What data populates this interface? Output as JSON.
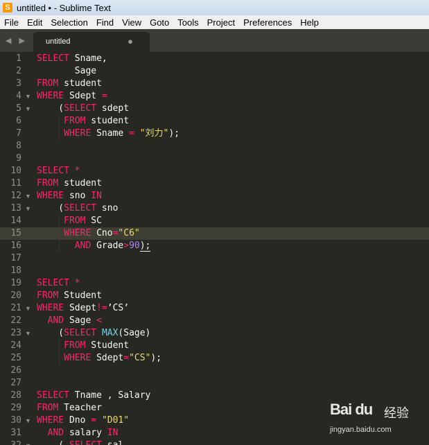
{
  "window": {
    "title": "untitled • - Sublime Text"
  },
  "menu": [
    "File",
    "Edit",
    "Selection",
    "Find",
    "View",
    "Goto",
    "Tools",
    "Project",
    "Preferences",
    "Help"
  ],
  "tab": {
    "label": "untitled",
    "dirty_indicator": "●"
  },
  "nav": {
    "arrows": "◀ ▶"
  },
  "highlighted_line": 15,
  "lines": [
    {
      "n": "1",
      "fold": false,
      "tokens": [
        {
          "t": "SELECT",
          "c": "kw"
        },
        {
          "t": " Sname,",
          "c": "id"
        }
      ]
    },
    {
      "n": "2",
      "fold": false,
      "tokens": [
        {
          "t": "       Sage",
          "c": "id"
        }
      ]
    },
    {
      "n": "3",
      "fold": false,
      "tokens": [
        {
          "t": "FROM",
          "c": "kw"
        },
        {
          "t": " student",
          "c": "id"
        }
      ]
    },
    {
      "n": "4",
      "fold": true,
      "tokens": [
        {
          "t": "WHERE",
          "c": "kw"
        },
        {
          "t": " Sdept ",
          "c": "id"
        },
        {
          "t": "=",
          "c": "kw"
        }
      ]
    },
    {
      "n": "5",
      "fold": true,
      "tokens": [
        {
          "t": "    (",
          "c": "id"
        },
        {
          "t": "SELECT",
          "c": "kw"
        },
        {
          "t": " sdept",
          "c": "id"
        }
      ]
    },
    {
      "n": "6",
      "fold": false,
      "tokens": [
        {
          "t": "     ",
          "c": "id"
        },
        {
          "t": "FROM",
          "c": "kw"
        },
        {
          "t": " student",
          "c": "id"
        }
      ]
    },
    {
      "n": "7",
      "fold": false,
      "tokens": [
        {
          "t": "     ",
          "c": "id"
        },
        {
          "t": "WHERE",
          "c": "kw"
        },
        {
          "t": " Sname ",
          "c": "id"
        },
        {
          "t": "=",
          "c": "kw"
        },
        {
          "t": " ",
          "c": "id"
        },
        {
          "t": "\"刘力\"",
          "c": "str"
        },
        {
          "t": ");",
          "c": "id"
        }
      ]
    },
    {
      "n": "8",
      "fold": false,
      "tokens": []
    },
    {
      "n": "9",
      "fold": false,
      "tokens": []
    },
    {
      "n": "10",
      "fold": false,
      "tokens": [
        {
          "t": "SELECT",
          "c": "kw"
        },
        {
          "t": " ",
          "c": "id"
        },
        {
          "t": "*",
          "c": "kw"
        }
      ]
    },
    {
      "n": "11",
      "fold": false,
      "tokens": [
        {
          "t": "FROM",
          "c": "kw"
        },
        {
          "t": " student",
          "c": "id"
        }
      ]
    },
    {
      "n": "12",
      "fold": true,
      "tokens": [
        {
          "t": "WHERE",
          "c": "kw"
        },
        {
          "t": " sno ",
          "c": "id"
        },
        {
          "t": "IN",
          "c": "kw"
        }
      ]
    },
    {
      "n": "13",
      "fold": true,
      "tokens": [
        {
          "t": "    (",
          "c": "id"
        },
        {
          "t": "SELECT",
          "c": "kw"
        },
        {
          "t": " sno",
          "c": "id"
        }
      ]
    },
    {
      "n": "14",
      "fold": false,
      "tokens": [
        {
          "t": "     ",
          "c": "id"
        },
        {
          "t": "FROM",
          "c": "kw"
        },
        {
          "t": " SC",
          "c": "id"
        }
      ]
    },
    {
      "n": "15",
      "fold": false,
      "tokens": [
        {
          "t": "     ",
          "c": "id"
        },
        {
          "t": "WHERE",
          "c": "kw"
        },
        {
          "t": " Cno",
          "c": "id"
        },
        {
          "t": "=",
          "c": "kw"
        },
        {
          "t": "\"C6\"",
          "c": "str"
        }
      ]
    },
    {
      "n": "16",
      "fold": false,
      "tokens": [
        {
          "t": "       ",
          "c": "id"
        },
        {
          "t": "AND",
          "c": "kw"
        },
        {
          "t": " Grade",
          "c": "id"
        },
        {
          "t": ">",
          "c": "kw"
        },
        {
          "t": "90",
          "c": "num"
        },
        {
          "t": ");",
          "c": "id ul"
        }
      ]
    },
    {
      "n": "17",
      "fold": false,
      "tokens": []
    },
    {
      "n": "18",
      "fold": false,
      "tokens": []
    },
    {
      "n": "19",
      "fold": false,
      "tokens": [
        {
          "t": "SELECT",
          "c": "kw"
        },
        {
          "t": " ",
          "c": "id"
        },
        {
          "t": "*",
          "c": "kw"
        }
      ]
    },
    {
      "n": "20",
      "fold": false,
      "tokens": [
        {
          "t": "FROM",
          "c": "kw"
        },
        {
          "t": " Student",
          "c": "id"
        }
      ]
    },
    {
      "n": "21",
      "fold": true,
      "tokens": [
        {
          "t": "WHERE",
          "c": "kw"
        },
        {
          "t": " Sdept",
          "c": "id"
        },
        {
          "t": "!=",
          "c": "kw"
        },
        {
          "t": "’CS’",
          "c": "id"
        }
      ]
    },
    {
      "n": "22",
      "fold": false,
      "tokens": [
        {
          "t": "  ",
          "c": "id"
        },
        {
          "t": "AND",
          "c": "kw"
        },
        {
          "t": " Sage ",
          "c": "id"
        },
        {
          "t": "<",
          "c": "kw"
        }
      ]
    },
    {
      "n": "23",
      "fold": true,
      "tokens": [
        {
          "t": "    (",
          "c": "id"
        },
        {
          "t": "SELECT",
          "c": "kw"
        },
        {
          "t": " ",
          "c": "id"
        },
        {
          "t": "MAX",
          "c": "fn"
        },
        {
          "t": "(Sage)",
          "c": "id"
        }
      ]
    },
    {
      "n": "24",
      "fold": false,
      "tokens": [
        {
          "t": "     ",
          "c": "id"
        },
        {
          "t": "FROM",
          "c": "kw"
        },
        {
          "t": " Student",
          "c": "id"
        }
      ]
    },
    {
      "n": "25",
      "fold": false,
      "tokens": [
        {
          "t": "     ",
          "c": "id"
        },
        {
          "t": "WHERE",
          "c": "kw"
        },
        {
          "t": " Sdept",
          "c": "id"
        },
        {
          "t": "=",
          "c": "kw"
        },
        {
          "t": "\"CS\"",
          "c": "str"
        },
        {
          "t": ");",
          "c": "id"
        }
      ]
    },
    {
      "n": "26",
      "fold": false,
      "tokens": []
    },
    {
      "n": "27",
      "fold": false,
      "tokens": []
    },
    {
      "n": "28",
      "fold": false,
      "tokens": [
        {
          "t": "SELECT",
          "c": "kw"
        },
        {
          "t": " Tname , Salary",
          "c": "id"
        }
      ]
    },
    {
      "n": "29",
      "fold": false,
      "tokens": [
        {
          "t": "FROM",
          "c": "kw"
        },
        {
          "t": " Teacher",
          "c": "id"
        }
      ]
    },
    {
      "n": "30",
      "fold": true,
      "tokens": [
        {
          "t": "WHERE",
          "c": "kw"
        },
        {
          "t": " Dno ",
          "c": "id"
        },
        {
          "t": "=",
          "c": "kw"
        },
        {
          "t": " ",
          "c": "id"
        },
        {
          "t": "\"D01\"",
          "c": "str"
        }
      ]
    },
    {
      "n": "31",
      "fold": false,
      "tokens": [
        {
          "t": "  ",
          "c": "id"
        },
        {
          "t": "AND",
          "c": "kw"
        },
        {
          "t": " salary ",
          "c": "id"
        },
        {
          "t": "IN",
          "c": "kw"
        }
      ]
    },
    {
      "n": "32",
      "fold": true,
      "tokens": [
        {
          "t": "    ( ",
          "c": "id"
        },
        {
          "t": "SELECT",
          "c": "kw"
        },
        {
          "t": " sal",
          "c": "id"
        }
      ]
    }
  ],
  "watermark": {
    "logo": "Bai du",
    "brand": "经验",
    "url": "jingyan.baidu.com"
  }
}
